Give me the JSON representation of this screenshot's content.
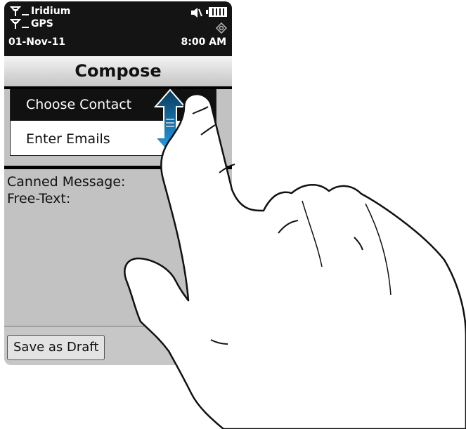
{
  "status": {
    "network1": "Iridium",
    "network2": "GPS",
    "date": "01-Nov-11",
    "time": "8:00 AM",
    "icons": [
      "antenna-icon",
      "mute-icon",
      "battery-icon",
      "gps-target-icon"
    ]
  },
  "header": {
    "title": "Compose"
  },
  "contact_menu": {
    "items": [
      {
        "label": "Choose Contact",
        "selected": true
      },
      {
        "label": "Enter Emails",
        "selected": false
      }
    ]
  },
  "fields": {
    "canned": "Canned Message:",
    "freetext": "Free-Text:"
  },
  "footer": {
    "save_draft": "Save as Draft"
  },
  "colors": {
    "accent": "#1e8fd8",
    "statusbar": "#141414",
    "selected": "#111111"
  }
}
